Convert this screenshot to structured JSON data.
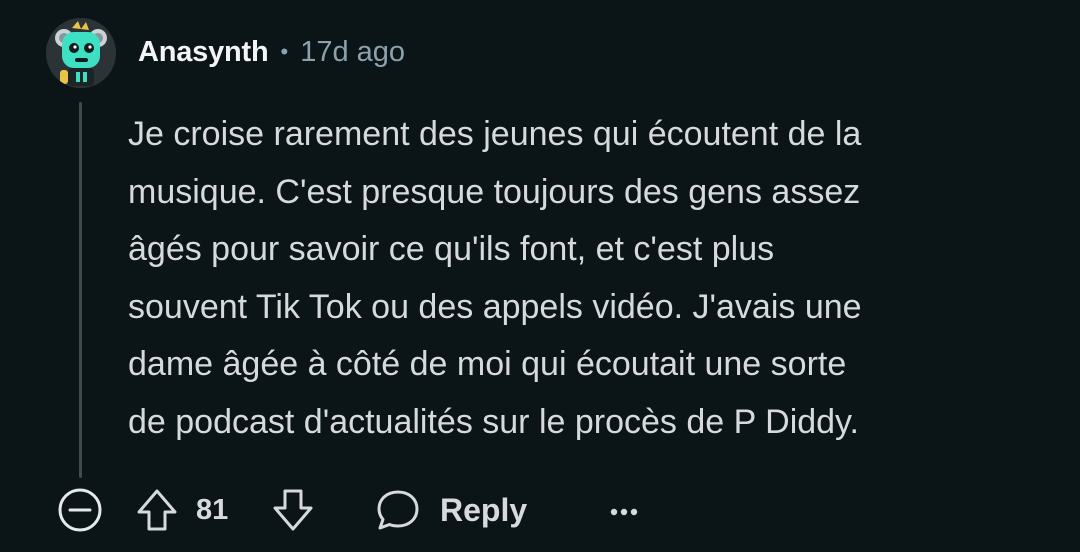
{
  "comment": {
    "username": "Anasynth",
    "separator": "•",
    "timestamp": "17d ago",
    "avatar_icon": "robot-avatar-icon",
    "body_lines": [
      "Je croise rarement des jeunes qui écoutent de la",
      "musique. C'est presque toujours des gens assez",
      "âgés pour savoir ce qu'ils font, et c'est plus",
      "souvent Tik Tok ou des appels vidéo. J'avais une",
      "dame âgée à côté de moi qui écoutait une sorte",
      "de podcast d'actualités sur le procès de P Diddy."
    ]
  },
  "actions": {
    "collapse_icon": "collapse-minus-icon",
    "upvote_icon": "upvote-arrow-icon",
    "score": "81",
    "downvote_icon": "downvote-arrow-icon",
    "reply_icon": "speech-bubble-icon",
    "reply_label": "Reply",
    "more_icon": "more-options-icon"
  },
  "colors": {
    "background": "#0b1416",
    "text_primary": "#d7dadc",
    "text_secondary": "#8ba2ad",
    "thread_line": "#3e4a4f",
    "avatar_accent": "#3ee0c4"
  }
}
